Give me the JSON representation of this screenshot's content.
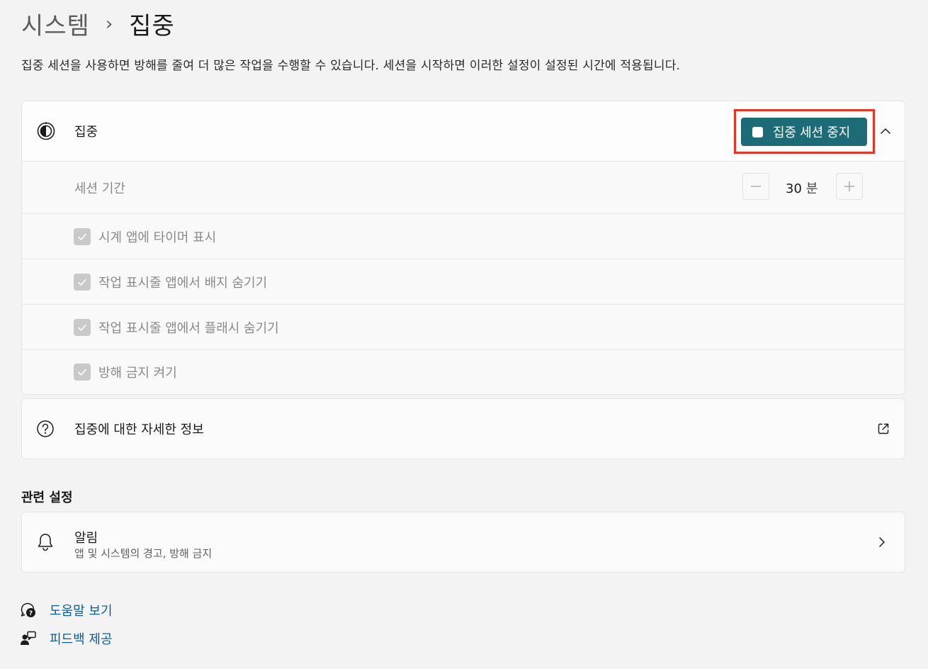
{
  "breadcrumb": {
    "parent": "시스템",
    "separator": "›",
    "current": "집중"
  },
  "description": "집중 세션을 사용하면 방해를 줄여 더 많은 작업을 수행할 수 있습니다. 세션을 시작하면 이러한 설정이 설정된 시간에 적용됩니다.",
  "focus": {
    "title": "집중",
    "stop_button_label": "집중 세션 중지",
    "accent_color": "#1c6b76",
    "highlight_color": "#ea3323",
    "expanded": true,
    "session": {
      "label": "세션 기간",
      "value": "30",
      "unit": "분"
    },
    "options": [
      {
        "label": "시계 앱에 타이머 표시",
        "checked": true,
        "disabled": true
      },
      {
        "label": "작업 표시줄 앱에서 배지 숨기기",
        "checked": true,
        "disabled": true
      },
      {
        "label": "작업 표시줄 앱에서 플래시 숨기기",
        "checked": true,
        "disabled": true
      },
      {
        "label": "방해 금지 켜기",
        "checked": true,
        "disabled": true
      }
    ]
  },
  "info": {
    "title": "집중에 대한 자세한 정보"
  },
  "related": {
    "section_title": "관련 설정",
    "notifications": {
      "title": "알림",
      "subtitle": "앱 및 시스템의 경고, 방해 금지"
    }
  },
  "footer": {
    "help_label": "도움말 보기",
    "feedback_label": "피드백 제공"
  }
}
